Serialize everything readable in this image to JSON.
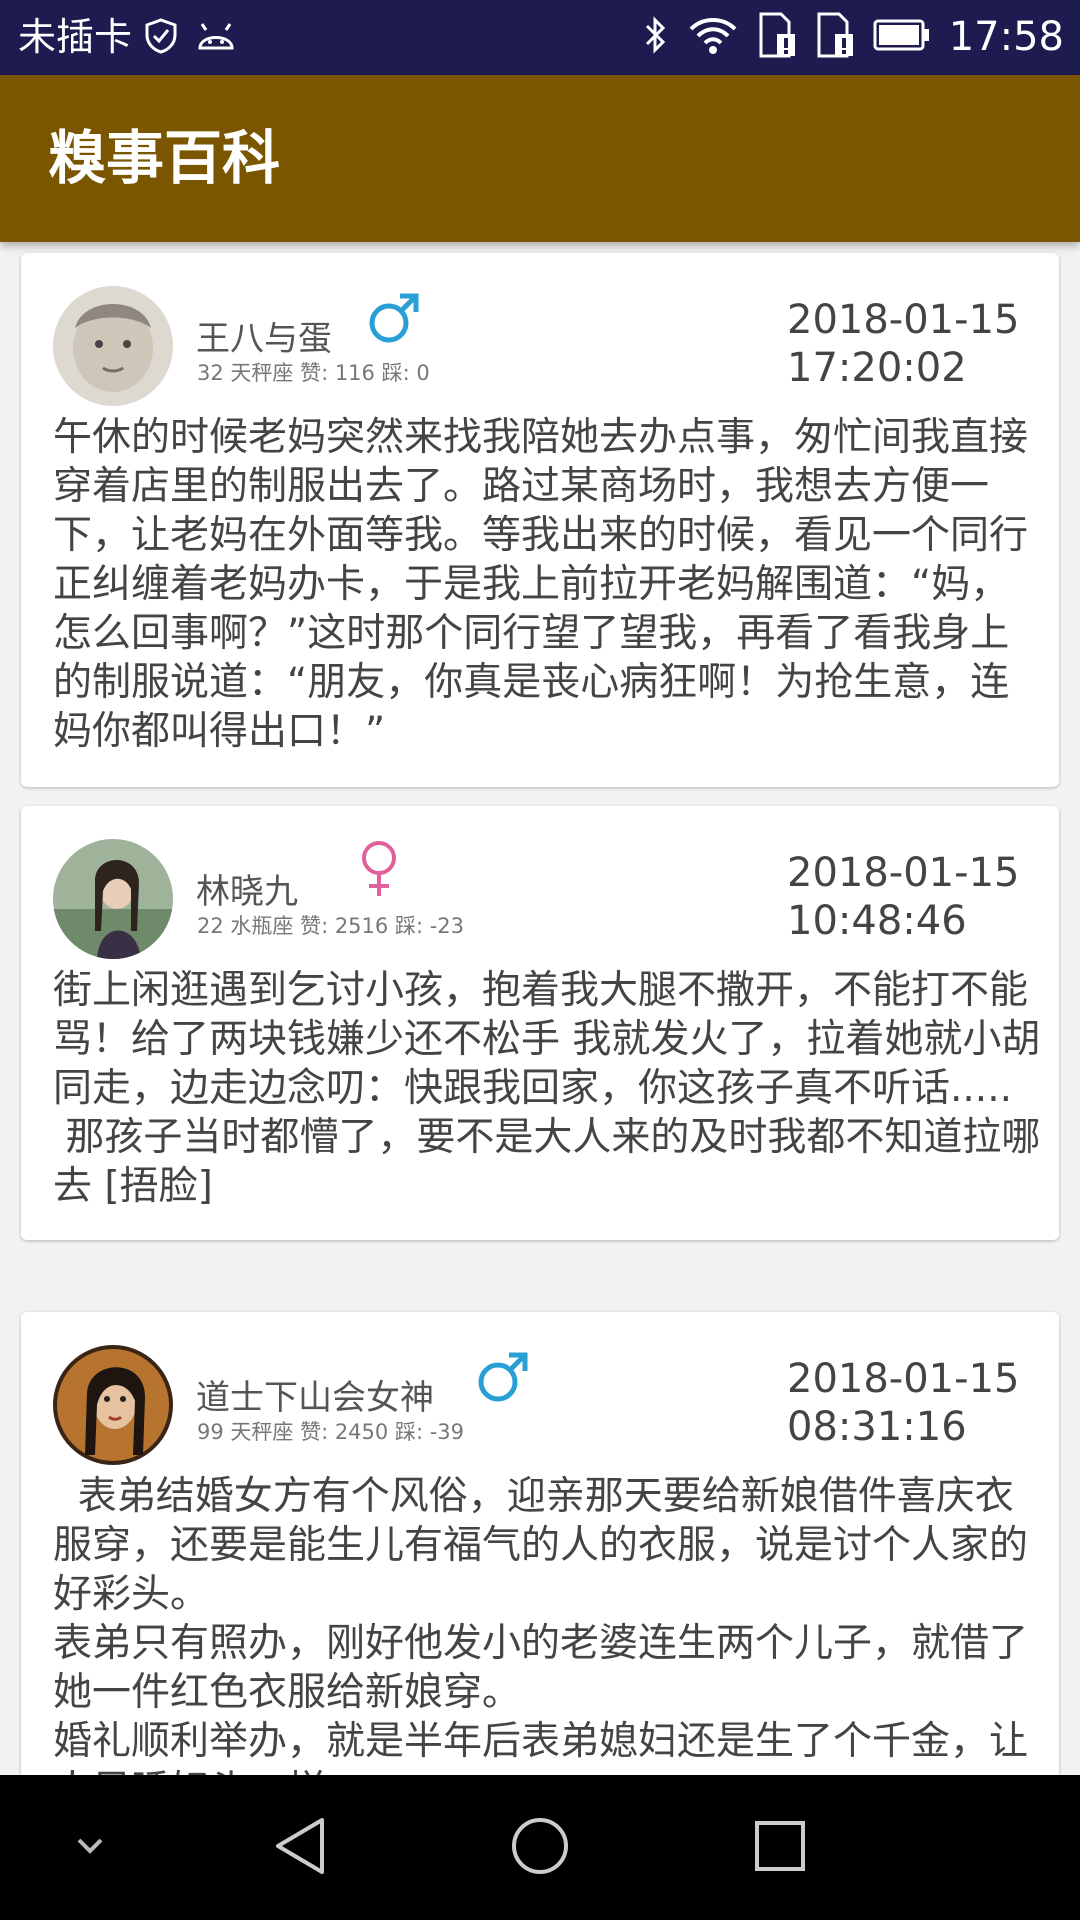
{
  "status_bar": {
    "carrier": "未插卡",
    "time": "17:58",
    "icons": [
      "shield-icon",
      "android-icon",
      "bluetooth-icon",
      "wifi-icon",
      "sim-1-icon",
      "sim-2-icon",
      "battery-icon"
    ]
  },
  "app_bar": {
    "title": "糗事百科"
  },
  "posts": [
    {
      "name": "王八与蛋",
      "meta": "32 天秤座 赞: 116 踩: 0",
      "gender": "male",
      "date": "2018-01-15",
      "time": "17:20:02",
      "content": "午休的时候老妈突然来找我陪她去办点事，匆忙间我直接穿着店里的制服出去了。路过某商场时，我想去方便一下，让老妈在外面等我。等我出来的时候，看见一个同行正纠缠着老妈办卡，于是我上前拉开老妈解围道：“妈，怎么回事啊？”这时那个同行望了望我，再看了看我身上的制服说道：“朋友，你真是丧心病狂啊！为抢生意，连妈你都叫得出口！”"
    },
    {
      "name": "林晓九",
      "meta": "22 水瓶座 赞: 2516 踩: -23",
      "gender": "female",
      "date": "2018-01-15",
      "time": "10:48:46",
      "content": "街上闲逛遇到乞讨小孩，抱着我大腿不撒开，不能打不能骂！给了两块钱嫌少还不松手 我就发火了，拉着她就小胡同走，边走边念叨：快跟我回家，你这孩子真不听话.....\n 那孩子当时都懵了，要不是大人来的及时我都不知道拉哪去 [捂脸]"
    },
    {
      "name": "道士下山会女神",
      "meta": "99 天秤座 赞: 2450 踩: -39",
      "gender": "male",
      "date": "2018-01-15",
      "time": "08:31:16",
      "content": "  表弟结婚女方有个风俗，迎亲那天要给新娘借件喜庆衣服穿，还要是能生儿有福气的人的衣服，说是讨个人家的好彩头。\n表弟只有照办，刚好他发小的老婆连生两个儿子，就借了她一件红色衣服给新娘穿。\n婚礼顺利举办，就是半年后表弟媳妇还是生了个千金，让人另睡好头一样..."
    }
  ],
  "nav_bar": {
    "buttons": [
      "chevron-down-icon",
      "back-icon",
      "home-icon",
      "recents-icon"
    ]
  },
  "colors": {
    "status_bar": "#1d1b4f",
    "app_bar": "#7a5600",
    "male": "#2a9fd6",
    "female": "#e0609a"
  }
}
